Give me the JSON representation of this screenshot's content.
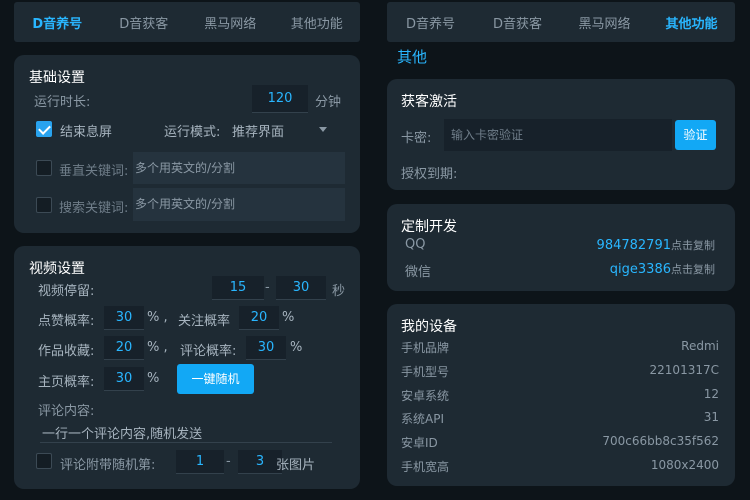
{
  "left_tabs": [
    "D音养号",
    "D音获客",
    "黑马网络",
    "其他功能"
  ],
  "right_tabs": [
    "D音养号",
    "D音获客",
    "黑马网络",
    "其他功能"
  ],
  "basic": {
    "title": "基础设置",
    "run_time_label": "运行时长:",
    "run_time_value": "120",
    "run_time_unit": "分钟",
    "end_screen_label": "结束息屏",
    "run_mode_label": "运行模式:",
    "run_mode_value": "推荐界面",
    "vertical_kw_label": "垂直关键词:",
    "vertical_kw_placeholder": "多个用英文的/分割",
    "search_kw_label": "搜索关键词:",
    "search_kw_placeholder": "多个用英文的/分割"
  },
  "video": {
    "title": "视频设置",
    "stay_label": "视频停留:",
    "stay_min": "15",
    "dash": "-",
    "stay_max": "30",
    "stay_unit": "秒",
    "like_label": "点赞概率:",
    "like_value": "30",
    "follow_label": "关注概率",
    "follow_value": "20",
    "collect_label": "作品收藏:",
    "collect_value": "20",
    "comment_label": "评论概率:",
    "comment_value": "30",
    "home_label": "主页概率:",
    "home_value": "30",
    "percent": "%",
    "percent_comma": "% ,",
    "random_button": "一键随机",
    "comment_content_label": "评论内容:",
    "comment_content_placeholder": "一行一个评论内容,随机发送",
    "attach_label": "评论附带随机第:",
    "attach_min": "1",
    "attach_max": "3",
    "attach_unit": "张图片"
  },
  "other": {
    "section_title": "其他",
    "activation": {
      "title": "获客激活",
      "key_label": "卡密:",
      "key_placeholder": "输入卡密验证",
      "verify_button": "验证",
      "expiry_label": "授权到期:"
    },
    "custom": {
      "title": "定制开发",
      "qq_label": "QQ",
      "qq_value": "984782791",
      "wechat_label": "微信",
      "wechat_value": "qige3386",
      "copy_hint": "点击复制"
    },
    "device": {
      "title": "我的设备",
      "rows": [
        {
          "label": "手机品牌",
          "value": "Redmi"
        },
        {
          "label": "手机型号",
          "value": "22101317C"
        },
        {
          "label": "安卓系统",
          "value": "12"
        },
        {
          "label": "系统API",
          "value": "31"
        },
        {
          "label": "安卓ID",
          "value": "700c66bb8c35f562"
        },
        {
          "label": "手机宽高",
          "value": "1080x2400"
        }
      ]
    }
  },
  "colors": {
    "accent": "#29b6ff",
    "card": "#1e2a33",
    "background": "#0d1419",
    "button": "#12a8f5"
  }
}
